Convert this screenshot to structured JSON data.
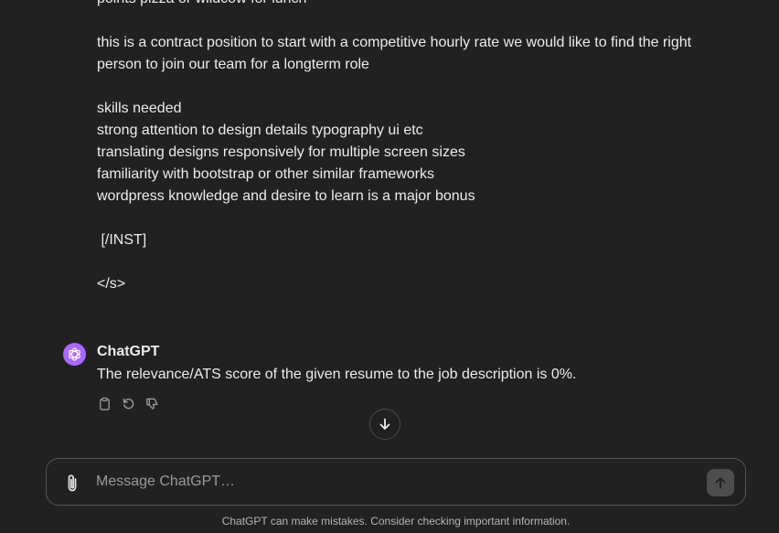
{
  "conversation": {
    "user_message_lines": [
      "points pizza or wildcow for lunch",
      "",
      "this is a contract position to start with a competitive hourly rate we would like to find the right",
      "person to join our team for a longterm role",
      "",
      "skills needed",
      "strong attention to design details typography ui etc",
      "translating designs responsively for multiple screen sizes",
      "familiarity with bootstrap or other similar frameworks",
      "wordpress knowledge and desire to learn is a major bonus",
      "",
      " [/INST]",
      "",
      "</s>"
    ],
    "assistant": {
      "author": "ChatGPT",
      "message": "The relevance/ATS score of the given resume to the job description is 0%.",
      "avatar_color": "#ab68ff",
      "actions": [
        "copy-icon",
        "regenerate-icon",
        "thumbs-down-icon"
      ]
    }
  },
  "composer": {
    "placeholder": "Message ChatGPT…",
    "value": ""
  },
  "footer": {
    "disclaimer": "ChatGPT can make mistakes. Consider checking important information."
  },
  "theme": {
    "background": "#212121",
    "text": "#ececec",
    "muted": "#b4b4b4"
  }
}
